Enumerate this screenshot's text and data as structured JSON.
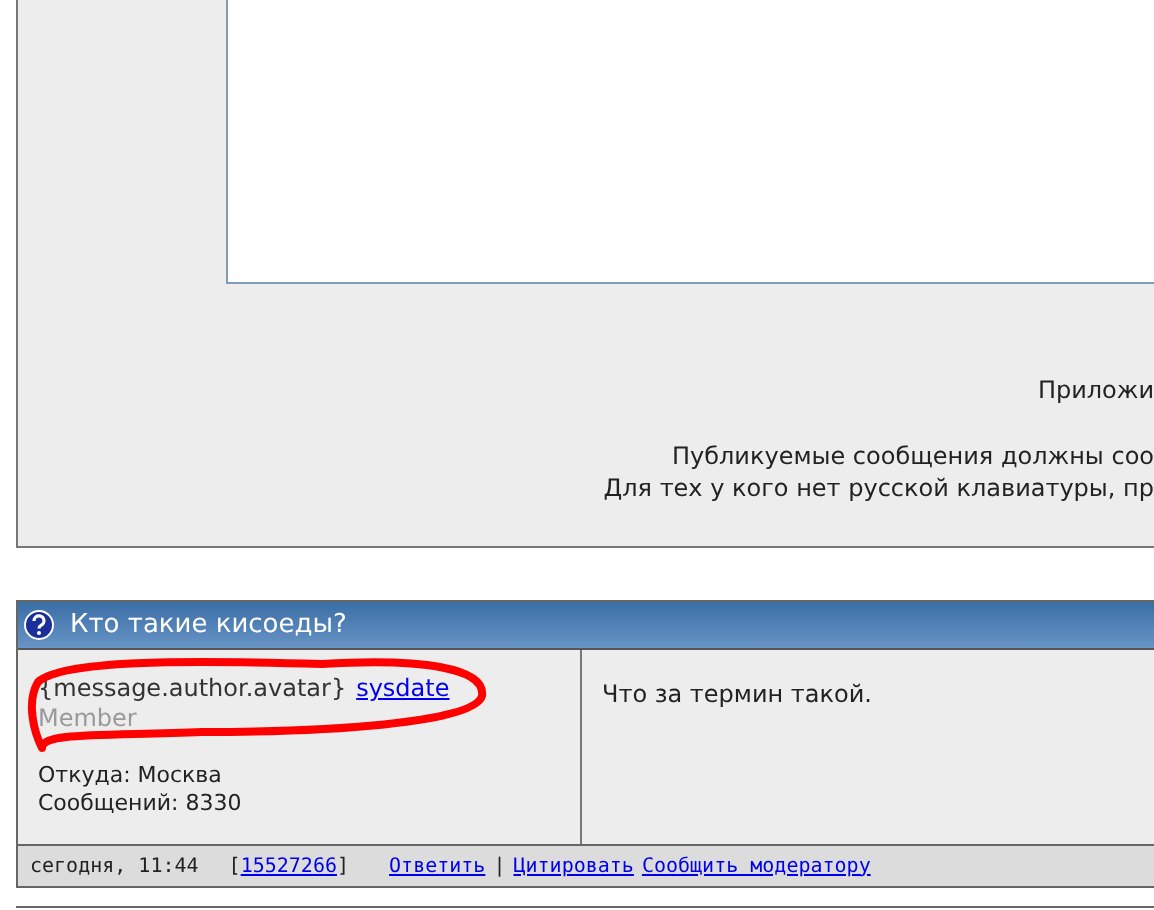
{
  "compose": {
    "notes": [
      "Приложи",
      "Публикуемые сообщения должны соо",
      "Для тех у кого нет русской клавиатуры, пр"
    ]
  },
  "post": {
    "title": "Кто такие кисоеды?",
    "author": {
      "avatar_tag": "{message.author.avatar}",
      "name_link": "sysdate",
      "rank": "Member",
      "location": "Откуда: Москва",
      "count": "Сообщений: 8330"
    },
    "body": "Что за термин такой.",
    "footer": {
      "time": "сегодня, 11:44",
      "id_open": "[",
      "id": "15527266",
      "id_close": "]",
      "actions": [
        {
          "label": "Ответить"
        },
        {
          "label": "Цитировать"
        },
        {
          "label": "Сообщить модератору"
        }
      ],
      "separator": "|"
    }
  }
}
